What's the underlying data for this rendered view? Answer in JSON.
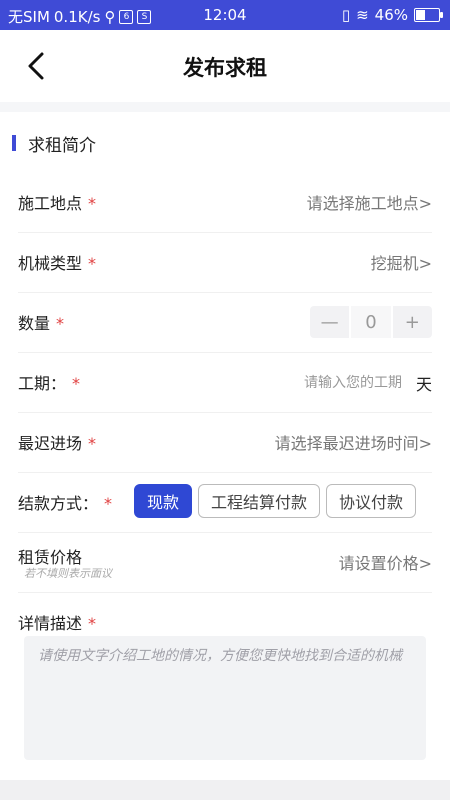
{
  "status_bar": {
    "carrier": "无SIM",
    "speed": "0.1K/s",
    "usb_icon": "usb-icon",
    "icon_box1": "6",
    "icon_box2": "S",
    "time": "12:04",
    "battery": "46%",
    "battery_level": 0.46
  },
  "navbar": {
    "title": "发布求租",
    "back_icon": "chevron-left-icon"
  },
  "section": {
    "title": "求租简介",
    "accent_color": "#3f4bd6"
  },
  "fields": {
    "site": {
      "label": "施工地点",
      "required": "*",
      "value": "请选择施工地点>"
    },
    "machine_type": {
      "label": "机械类型",
      "required": "*",
      "value": "挖掘机>"
    },
    "quantity": {
      "label": "数量",
      "required": "*",
      "minus": "—",
      "value": "0",
      "plus": "+"
    },
    "duration": {
      "label": "工期：",
      "required": "*",
      "placeholder": "请输入您的工期",
      "unit": "天"
    },
    "latest_entry": {
      "label": "最迟进场",
      "required": "*",
      "value": "请选择最迟进场时间>"
    },
    "payment": {
      "label": "结款方式：",
      "required": "*",
      "options": [
        "现款",
        "工程结算付款",
        "协议付款"
      ],
      "selected": "现款",
      "selected_color": "#2f48d4"
    },
    "price": {
      "label": "租赁价格",
      "hint": "若不填则表示面议",
      "value": "请设置价格>"
    },
    "description": {
      "label": "详情描述",
      "required": "*",
      "placeholder": "请使用文字介绍工地的情况，方便您更快地找到合适的机械"
    }
  }
}
